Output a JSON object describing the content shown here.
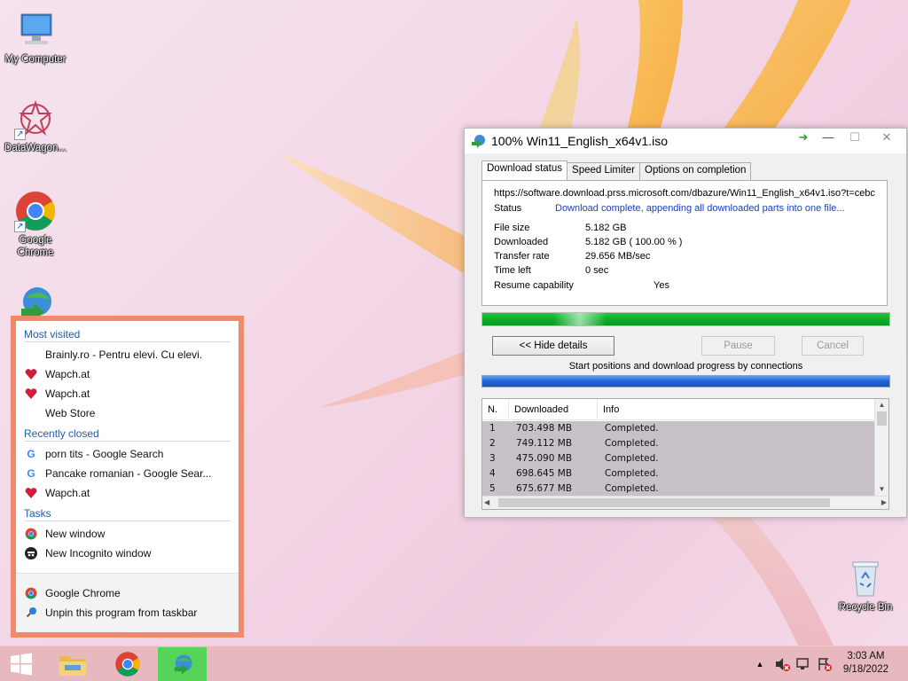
{
  "desktop": {
    "icons": [
      {
        "label": "My Computer",
        "icon": "computer-icon"
      },
      {
        "label": "DataWagon...",
        "icon": "datawagon-icon"
      },
      {
        "label": "Google Chrome",
        "icon": "chrome-icon"
      },
      {
        "label": "",
        "icon": "idm-icon"
      },
      {
        "label": "Recycle Bin",
        "icon": "recycle-bin-icon"
      }
    ]
  },
  "jumplist": {
    "most_visited_header": "Most visited",
    "most_visited": [
      {
        "label": "Brainly.ro - Pentru elevi. Cu elevi.",
        "icon": "none"
      },
      {
        "label": "Wapch.at",
        "icon": "heart-icon"
      },
      {
        "label": "Wapch.at",
        "icon": "heart-icon"
      },
      {
        "label": "Web Store",
        "icon": "none"
      }
    ],
    "recently_closed_header": "Recently closed",
    "recently_closed": [
      {
        "label": "porn tits - Google Search",
        "icon": "google-icon"
      },
      {
        "label": "Pancake romanian - Google Sear...",
        "icon": "google-icon"
      },
      {
        "label": "Wapch.at",
        "icon": "heart-icon"
      }
    ],
    "tasks_header": "Tasks",
    "tasks": [
      {
        "label": "New window",
        "icon": "chrome-icon"
      },
      {
        "label": "New Incognito window",
        "icon": "incognito-icon"
      }
    ],
    "footer": [
      {
        "label": "Google Chrome",
        "icon": "chrome-icon"
      },
      {
        "label": "Unpin this program from taskbar",
        "icon": "unpin-icon"
      }
    ]
  },
  "idm": {
    "title": "100% Win11_English_x64v1.iso",
    "tabs": [
      "Download status",
      "Speed Limiter",
      "Options on completion"
    ],
    "url": "https://software.download.prss.microsoft.com/dbazure/Win11_English_x64v1.iso?t=cebc",
    "status_label": "Status",
    "status_value": "Download complete, appending all downloaded parts into one file...",
    "file_size_label": "File size",
    "file_size_value": "5.182  GB",
    "downloaded_label": "Downloaded",
    "downloaded_value": "5.182  GB  ( 100.00 % )",
    "transfer_rate_label": "Transfer rate",
    "transfer_rate_value": "29.656  MB/sec",
    "time_left_label": "Time left",
    "time_left_value": "0 sec",
    "resume_label": "Resume capability",
    "resume_value": "Yes",
    "progress_percent": 100,
    "hide_details_label": "<< Hide details",
    "pause_label": "Pause",
    "cancel_label": "Cancel",
    "connections_label": "Start positions and download progress by connections",
    "table": {
      "columns": [
        "N.",
        "Downloaded",
        "Info"
      ],
      "rows": [
        {
          "n": "1",
          "downloaded": "703.498  MB",
          "info": "Completed."
        },
        {
          "n": "2",
          "downloaded": "749.112  MB",
          "info": "Completed."
        },
        {
          "n": "3",
          "downloaded": "475.090  MB",
          "info": "Completed."
        },
        {
          "n": "4",
          "downloaded": "698.645  MB",
          "info": "Completed."
        },
        {
          "n": "5",
          "downloaded": "675.677  MB",
          "info": "Completed."
        }
      ]
    }
  },
  "taskbar": {
    "time": "3:03 AM",
    "date": "9/18/2022"
  }
}
